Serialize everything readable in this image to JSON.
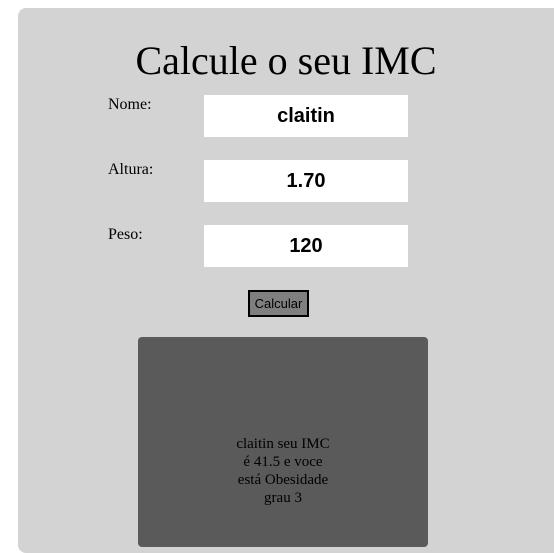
{
  "page": {
    "title": "Calcule o seu IMC"
  },
  "form": {
    "nome_label": "Nome:",
    "nome_value": "claitin",
    "altura_label": "Altura:",
    "altura_value": "1.70",
    "peso_label": "Peso:",
    "peso_value": "120",
    "calcular_label": "Calcular"
  },
  "result": {
    "text": "claitin seu IMC é 41.5 e voce está Obesidade grau 3"
  },
  "colors": {
    "card_background": "#d3d3d3",
    "result_background": "#5a5a5a",
    "button_background": "#7f7f7f"
  }
}
